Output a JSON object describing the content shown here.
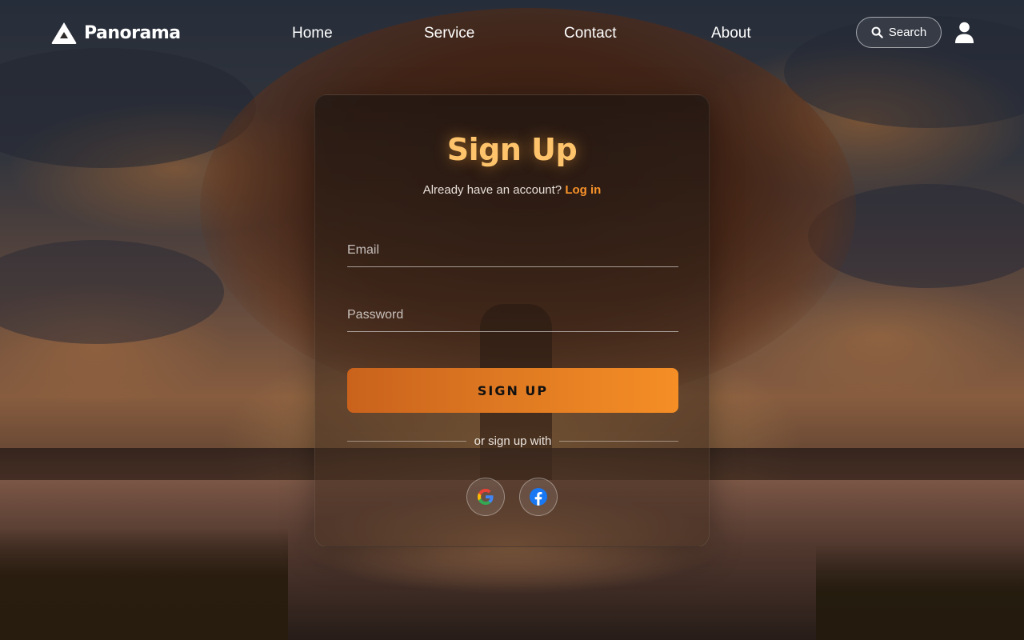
{
  "brand": {
    "name": "Panorama",
    "icon": "mountain-icon"
  },
  "nav": {
    "links": [
      {
        "label": "Home"
      },
      {
        "label": "Service"
      },
      {
        "label": "Contact"
      },
      {
        "label": "About"
      }
    ],
    "search_label": "Search",
    "search_icon": "search-icon",
    "user_icon": "user-icon"
  },
  "form": {
    "title": "Sign Up",
    "account_prompt": "Already have an account?",
    "login_label": "Log in",
    "email_placeholder": "Email",
    "email_value": "",
    "password_placeholder": "Password",
    "password_value": "",
    "submit_label": "SIGN UP",
    "divider_text": "or sign up with",
    "social": [
      {
        "name": "Google",
        "icon": "google-icon"
      },
      {
        "name": "Facebook",
        "icon": "facebook-icon"
      }
    ]
  },
  "colors": {
    "accent": "#f7922a",
    "title": "#ffc46b",
    "button_start": "#c9621c",
    "button_end": "#f58e25",
    "facebook": "#1877f2"
  }
}
